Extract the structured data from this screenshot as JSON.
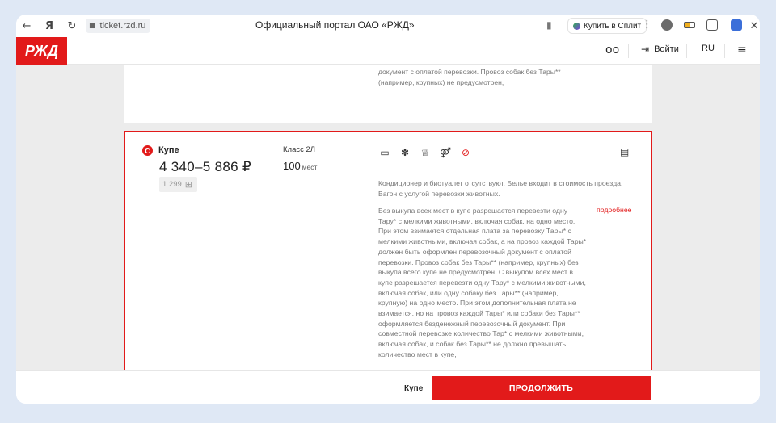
{
  "browser": {
    "url": "ticket.rzd.ru",
    "tab_title": "Официальный портал ОАО «РЖД»",
    "split_button": "Купить в Сплит"
  },
  "site": {
    "logo": "РЖД",
    "login_label": "Войти",
    "language": "RU"
  },
  "previous_card": {
    "text": "собак, на провоз каждой Тары* оформляется перевозочный документ с оплатой перевозки. Провоз собак без Тары** (например, крупных) не предусмотрен,"
  },
  "car_option": {
    "class_name": "Купе",
    "price_range": "4 340–5 886 ₽",
    "bonus_points": "1 299",
    "car_class": "Класс 2Л",
    "seats_count": "100",
    "seats_unit": "мест",
    "amenity_icons": [
      "bed-icon",
      "paw-icon",
      "award-icon",
      "couple-icon",
      "no-smoking-icon"
    ],
    "description": "Кондиционер и биотуалет отсутствуют. Белье входит в стоимость проезда. Вагон с услугой перевозки животных.",
    "pets_info": "Без выкупа всех мест в купе разрешается перевезти одну Тару* с мелкими животными, включая собак, на одно место. При этом взимается отдельная плата за перевозку Тары* с мелкими животными, включая собак, а на провоз каждой Тары* должен быть оформлен перевозочный документ с оплатой перевозки. Провоз собак без Тары** (например, крупных) без выкупа всего купе не предусмотрен. С выкупом всех мест в купе разрешается перевезти одну Тару* с мелкими животными, включая собак, или одну собаку без Тары** (например, крупную) на одно место. При этом дополнительная плата не взимается, но на провоз каждой Тары* или собаки без Тары** оформляется безденежный перевозочный документ. При совместной перевозке количество Тар* с мелкими животными, включая собак, и собак без Тары** не должно превышать количество мест в купе,",
    "more_link": "подробнее"
  },
  "bottom_bar": {
    "selected_class": "Купе",
    "continue_label": "ПРОДОЛЖИТЬ"
  },
  "colors": {
    "brand_red": "#e21a1a",
    "background": "#dfe8f5"
  }
}
